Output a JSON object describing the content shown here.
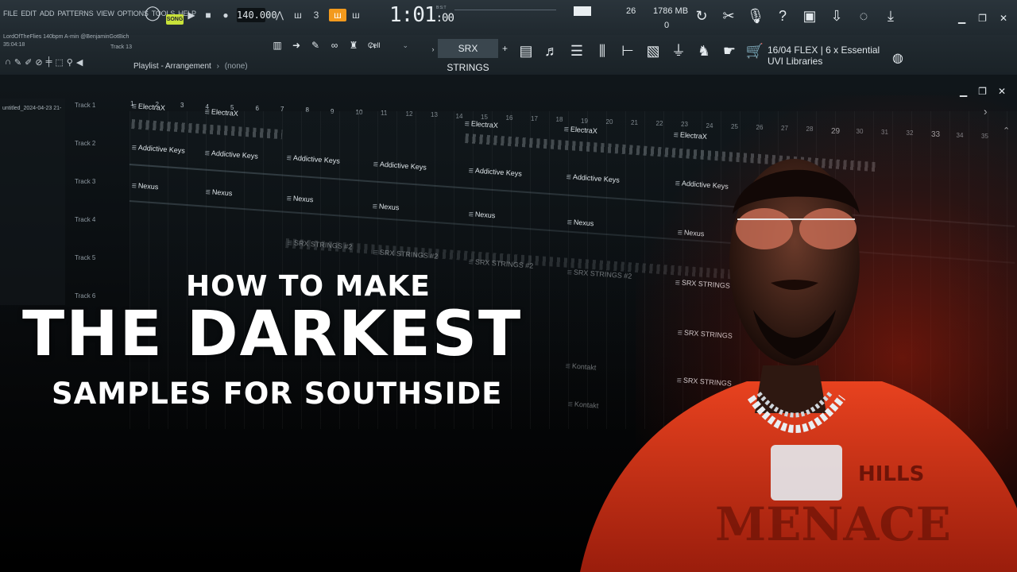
{
  "menu": [
    "FILE",
    "EDIT",
    "ADD",
    "PATTERNS",
    "VIEW",
    "OPTIONS",
    "TOOLS",
    "HELP"
  ],
  "transport": {
    "song_mode": "SONG",
    "tempo": "140.000",
    "time_main": "1:01",
    "time_sub": ":00",
    "time_label": "B:S:T"
  },
  "monitor": {
    "cpu": "26",
    "memory": "1786 MB",
    "polyphony": "0"
  },
  "project": {
    "info_line1": "LordOfTheFlies 140bpm A-min @BenjaminGotBich",
    "info_line2": "35:04:18",
    "track_label": "Track 13"
  },
  "toolbar2": {
    "snap": "Cell",
    "pattern": "SRX STRINGS",
    "plus": "+",
    "news_line1": "16/04  FLEX | 6 x Essential",
    "news_line2": "UVI Libraries"
  },
  "playlist": {
    "title": "Playlist - Arrangement",
    "arrangement": "(none)",
    "file_item": "untitled_2024-04-23 21-",
    "tracks": [
      "Track 1",
      "Track 2",
      "Track 3",
      "Track 4",
      "Track 5",
      "Track 6"
    ],
    "bars": [
      "1",
      "2",
      "3",
      "4",
      "5",
      "6",
      "7",
      "8",
      "9",
      "10",
      "11",
      "12",
      "13",
      "14",
      "15",
      "16",
      "17",
      "18",
      "19",
      "20",
      "21",
      "22",
      "23",
      "24",
      "25",
      "26",
      "27",
      "28",
      "29",
      "30",
      "31",
      "32",
      "33",
      "34",
      "35"
    ]
  },
  "clips": [
    {
      "label": "ElectraX"
    },
    {
      "label": "ElectraX"
    },
    {
      "label": "ElectraX"
    },
    {
      "label": "ElectraX"
    },
    {
      "label": "ElectraX"
    },
    {
      "label": "Addictive Keys"
    },
    {
      "label": "Addictive Keys"
    },
    {
      "label": "Addictive Keys"
    },
    {
      "label": "Addictive Keys"
    },
    {
      "label": "Addictive Keys"
    },
    {
      "label": "Addictive Keys"
    },
    {
      "label": "Addictive Keys"
    },
    {
      "label": "Nexus"
    },
    {
      "label": "Nexus"
    },
    {
      "label": "Nexus"
    },
    {
      "label": "Nexus"
    },
    {
      "label": "Nexus"
    },
    {
      "label": "Nexus"
    },
    {
      "label": "Nexus"
    },
    {
      "label": "SRX STRINGS #2"
    },
    {
      "label": "SRX STRINGS #2"
    },
    {
      "label": "SRX STRINGS #2"
    },
    {
      "label": "SRX STRINGS #2"
    },
    {
      "label": "SRX STRINGS"
    },
    {
      "label": "SRX STRINGS"
    },
    {
      "label": "SRX STRINGS"
    },
    {
      "label": "Kontakt"
    },
    {
      "label": "Kontakt"
    }
  ],
  "headline": {
    "line1": "HOW TO MAKE",
    "line2": "THE DARKEST",
    "line3": "SAMPLES FOR SOUTHSIDE"
  },
  "shirt_text": {
    "hills": "HILLS",
    "menace": "MENACE"
  },
  "colors": {
    "song_accent": "#c8e23a",
    "glow": "#b41e0a",
    "hoodie": "#d8381c"
  },
  "icons": [
    "metronome-icon",
    "wait-icon",
    "countdown-icon",
    "step-edit-icon",
    "loop-record-icon",
    "undo-icon",
    "cut-icon",
    "microphone-icon",
    "help-icon",
    "save-icon",
    "export-icon",
    "chat-icon",
    "download-icon"
  ]
}
